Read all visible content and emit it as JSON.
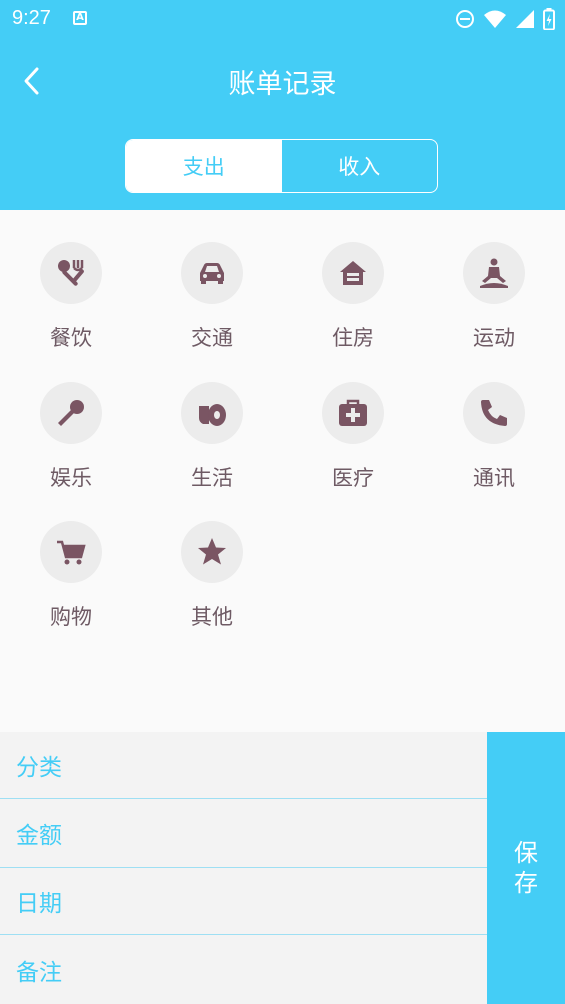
{
  "status_bar": {
    "time": "9:27",
    "notification_letter": "A"
  },
  "header": {
    "title": "账单记录"
  },
  "segments": [
    {
      "label": "支出",
      "active": true
    },
    {
      "label": "收入",
      "active": false
    }
  ],
  "categories": [
    {
      "label": "餐饮",
      "icon": "utensils-icon"
    },
    {
      "label": "交通",
      "icon": "car-icon"
    },
    {
      "label": "住房",
      "icon": "house-icon"
    },
    {
      "label": "运动",
      "icon": "yoga-icon"
    },
    {
      "label": "娱乐",
      "icon": "microphone-icon"
    },
    {
      "label": "生活",
      "icon": "toilet-paper-icon"
    },
    {
      "label": "医疗",
      "icon": "medical-kit-icon"
    },
    {
      "label": "通讯",
      "icon": "phone-icon"
    },
    {
      "label": "购物",
      "icon": "cart-icon"
    },
    {
      "label": "其他",
      "icon": "star-icon"
    }
  ],
  "form": {
    "fields": [
      {
        "label": "分类"
      },
      {
        "label": "金额"
      },
      {
        "label": "日期"
      },
      {
        "label": "备注"
      }
    ],
    "save_label": "保存"
  },
  "colors": {
    "accent": "#44cdf6",
    "icon": "#7a5563",
    "icon_bg": "#ececec",
    "label": "#6e5a64"
  }
}
